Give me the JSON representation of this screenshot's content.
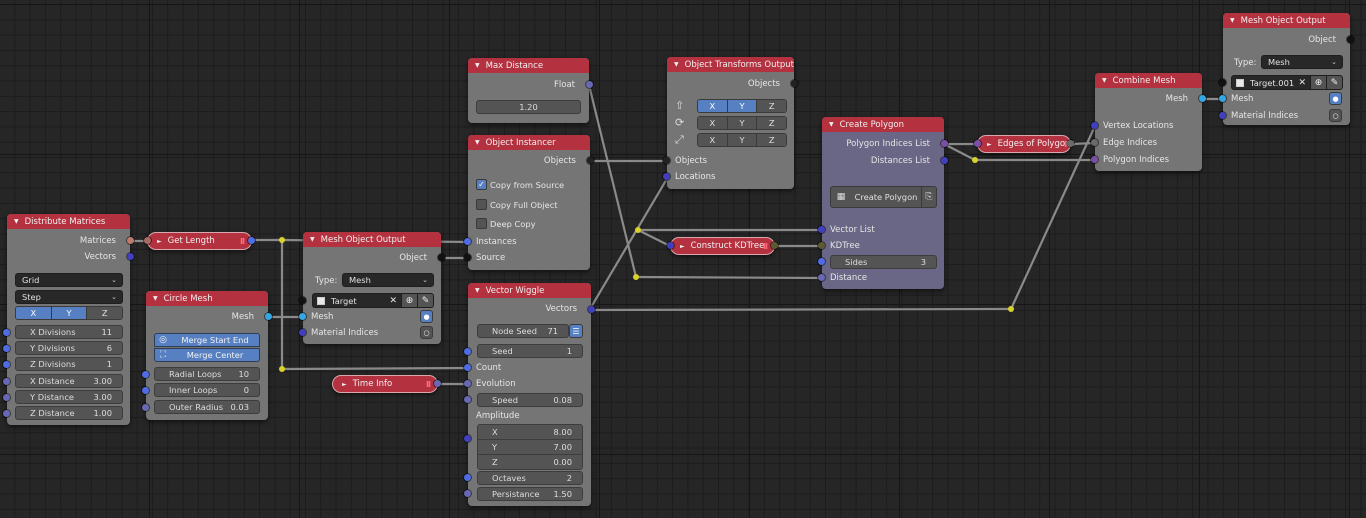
{
  "colors": {
    "node_header": "#b4313f",
    "node_body": "#757575",
    "node_body_purple": "#6a6686",
    "accent_blue": "#5680c2",
    "socket_matrix": "#c07b6f",
    "socket_vector": "#3f3fbf",
    "socket_float": "#6868b5",
    "socket_int": "#4e6ce6",
    "socket_mesh": "#33a6e6",
    "socket_object": "#111111",
    "socket_polygon": "#7b4fa8",
    "socket_kdtree": "#5c5a33",
    "reroute": "#d8d22a"
  },
  "nodes": {
    "distribute_matrices": {
      "title": "Distribute Matrices",
      "outputs": [
        "Matrices",
        "Vectors"
      ],
      "mode_dropdown": "Grid",
      "step_dropdown": "Step",
      "axes": [
        {
          "label": "X",
          "on": true
        },
        {
          "label": "Y",
          "on": true
        },
        {
          "label": "Z",
          "on": false
        }
      ],
      "fields": [
        {
          "label": "X Divisions",
          "value": "11"
        },
        {
          "label": "Y Divisions",
          "value": "6"
        },
        {
          "label": "Z Divisions",
          "value": "1"
        },
        {
          "label": "X Distance",
          "value": "3.00"
        },
        {
          "label": "Y Distance",
          "value": "3.00"
        },
        {
          "label": "Z Distance",
          "value": "1.00"
        }
      ]
    },
    "get_length": {
      "title": "Get Length"
    },
    "circle_mesh": {
      "title": "Circle Mesh",
      "output": "Mesh",
      "toggles": [
        "Merge Start End",
        "Merge Center"
      ],
      "fields": [
        {
          "label": "Radial Loops",
          "value": "10"
        },
        {
          "label": "Inner Loops",
          "value": "0"
        },
        {
          "label": "Outer Radius",
          "value": "0.03"
        }
      ]
    },
    "mesh_object_output_1": {
      "title": "Mesh Object Output",
      "output": "Object",
      "type_label": "Type:",
      "type_value": "Mesh",
      "target": "Target",
      "inputs": [
        "Mesh",
        "Material Indices"
      ]
    },
    "time_info": {
      "title": "Time Info"
    },
    "max_distance": {
      "title": "Max Distance",
      "output": "Float",
      "value": "1.20"
    },
    "object_instancer": {
      "title": "Object Instancer",
      "output": "Objects",
      "checkboxes": [
        {
          "label": "Copy from Source",
          "checked": true
        },
        {
          "label": "Copy Full Object",
          "checked": false
        },
        {
          "label": "Deep Copy",
          "checked": false
        }
      ],
      "inputs": [
        "Instances",
        "Source"
      ]
    },
    "vector_wiggle": {
      "title": "Vector Wiggle",
      "output": "Vectors",
      "node_seed_label": "Node Seed",
      "node_seed_value": "71",
      "seed": {
        "label": "Seed",
        "value": "1"
      },
      "inputs": [
        "Count",
        "Evolution"
      ],
      "speed": {
        "label": "Speed",
        "value": "0.08"
      },
      "amplitude_label": "Amplitude",
      "amplitude": [
        {
          "label": "X",
          "value": "8.00"
        },
        {
          "label": "Y",
          "value": "7.00"
        },
        {
          "label": "Z",
          "value": "0.00"
        }
      ],
      "octaves": {
        "label": "Octaves",
        "value": "2"
      },
      "persistance": {
        "label": "Persistance",
        "value": "1.50"
      }
    },
    "object_transforms_output": {
      "title": "Object Transforms Output",
      "output": "Objects",
      "rows": [
        {
          "icon": "location-icon",
          "axes": [
            {
              "label": "X",
              "on": true
            },
            {
              "label": "Y",
              "on": true
            },
            {
              "label": "Z",
              "on": false
            }
          ]
        },
        {
          "icon": "rotation-icon",
          "axes": [
            {
              "label": "X",
              "on": false
            },
            {
              "label": "Y",
              "on": false
            },
            {
              "label": "Z",
              "on": false
            }
          ]
        },
        {
          "icon": "scale-icon",
          "axes": [
            {
              "label": "X",
              "on": false
            },
            {
              "label": "Y",
              "on": false
            },
            {
              "label": "Z",
              "on": false
            }
          ]
        }
      ],
      "inputs": [
        "Objects",
        "Locations"
      ]
    },
    "construct_kdtree": {
      "title": "Construct KDTree"
    },
    "create_polygon": {
      "title": "Create Polygon",
      "outputs": [
        "Polygon Indices List",
        "Distances List"
      ],
      "button": "Create Polygon",
      "inputs": [
        "Vector List",
        "KDTree"
      ],
      "sides": {
        "label": "Sides",
        "value": "3"
      },
      "distance_input": "Distance"
    },
    "edges_of_polygons": {
      "title": "Edges of Polygons"
    },
    "combine_mesh": {
      "title": "Combine Mesh",
      "output": "Mesh",
      "inputs": [
        "Vertex Locations",
        "Edge Indices",
        "Polygon Indices"
      ]
    },
    "mesh_object_output_2": {
      "title": "Mesh Object Output",
      "output": "Object",
      "type_label": "Type:",
      "type_value": "Mesh",
      "target": "Target.001",
      "inputs": [
        "Mesh",
        "Material Indices"
      ]
    }
  },
  "icons": {
    "collapse": "▼",
    "expand": "►",
    "chevron": "⌄",
    "close": "✕",
    "plus": "⊕",
    "eyedropper": "✎",
    "pause": "II",
    "check": "✓"
  }
}
